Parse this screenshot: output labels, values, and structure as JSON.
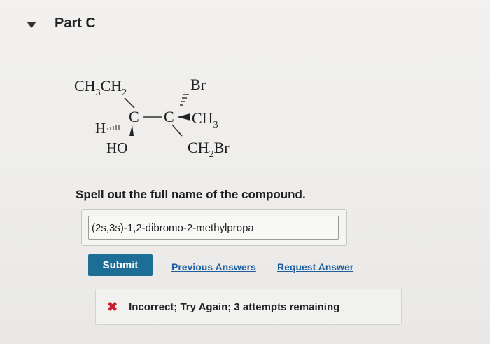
{
  "part": {
    "title": "Part C"
  },
  "structure": {
    "ethyl": {
      "main": "CH",
      "s1": "3",
      "mid": "CH",
      "s2": "2"
    },
    "br": "Br",
    "h": "H",
    "c1": "C",
    "c2": "C",
    "methyl": {
      "main": "CH",
      "s": "3"
    },
    "ho": "HO",
    "ch2br": {
      "a": "CH",
      "s": "2",
      "b": "Br"
    }
  },
  "question": {
    "prompt": "Spell out the full name of the compound."
  },
  "answer": {
    "value": "(2s,3s)-1,2-dibromo-2-methylpropa"
  },
  "actions": {
    "submit_label": "Submit",
    "previous_label": "Previous Answers",
    "request_label": "Request Answer"
  },
  "feedback": {
    "message": "Incorrect; Try Again; 3 attempts remaining"
  },
  "colors": {
    "submit": "#1d6e96",
    "link": "#1f5fa0",
    "error": "#c8202a"
  }
}
